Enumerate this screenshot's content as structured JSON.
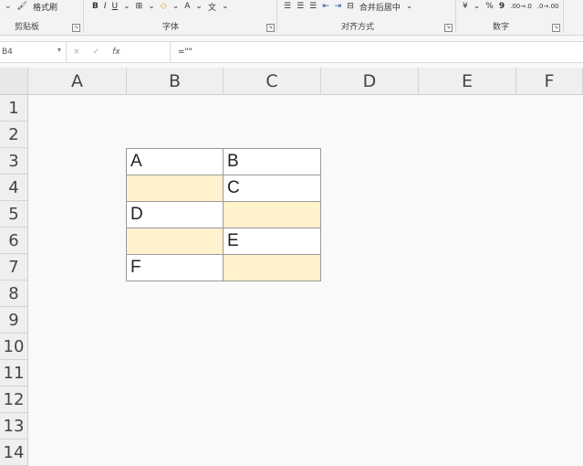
{
  "ribbon": {
    "format_painter": "格式刷",
    "bold": "B",
    "italic": "I",
    "underline": "U",
    "groups": {
      "clipboard": "剪贴板",
      "font": "字体",
      "alignment": "对齐方式",
      "number": "数字"
    },
    "merge_center": "合并后居中",
    "percent": "%",
    "comma": "9",
    "dec_increase": ".00→.0",
    "dec_decrease": ".0→.00"
  },
  "formula_bar": {
    "name_box": "B4",
    "cancel": "×",
    "enter": "✓",
    "fx": "fx",
    "content": "=\"\""
  },
  "columns": [
    "A",
    "B",
    "C",
    "D",
    "E",
    "F"
  ],
  "rows": [
    "1",
    "2",
    "3",
    "4",
    "5",
    "6",
    "7",
    "8",
    "9",
    "10",
    "11",
    "12",
    "13",
    "14"
  ],
  "table": {
    "rows": [
      [
        "A",
        "B"
      ],
      [
        "",
        "C"
      ],
      [
        "D",
        ""
      ],
      [
        "",
        "E"
      ],
      [
        "F",
        ""
      ]
    ],
    "fill_color": "#fff2cc"
  }
}
